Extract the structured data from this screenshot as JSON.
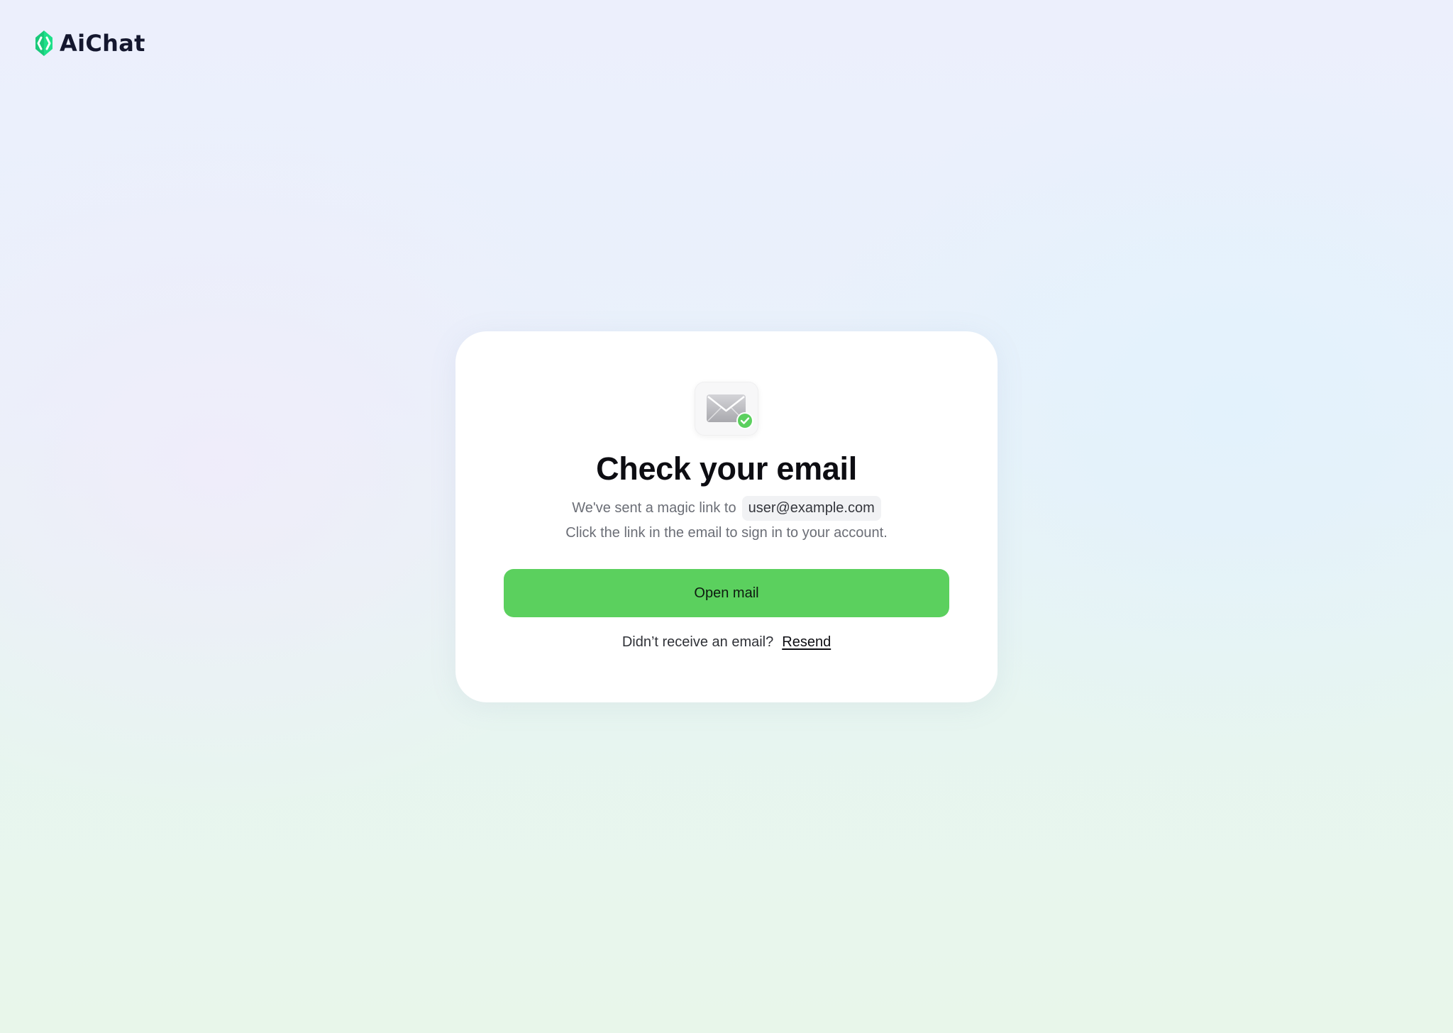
{
  "brand": {
    "name": "AiChat",
    "accent_color": "#1ee08a",
    "logo_icon": "aichat-logo-icon"
  },
  "card": {
    "icon": "email-sent-check-icon",
    "title": "Check your email",
    "sent_prefix": "We've sent a magic link to",
    "email": "user@example.com",
    "instruction": "Click the link in the email to sign in to your account.",
    "open_mail_label": "Open mail",
    "resend_prompt": "Didn’t receive an email?",
    "resend_label": "Resend"
  },
  "colors": {
    "primary_button": "#5bd05e",
    "check_badge": "#5bd05e"
  }
}
